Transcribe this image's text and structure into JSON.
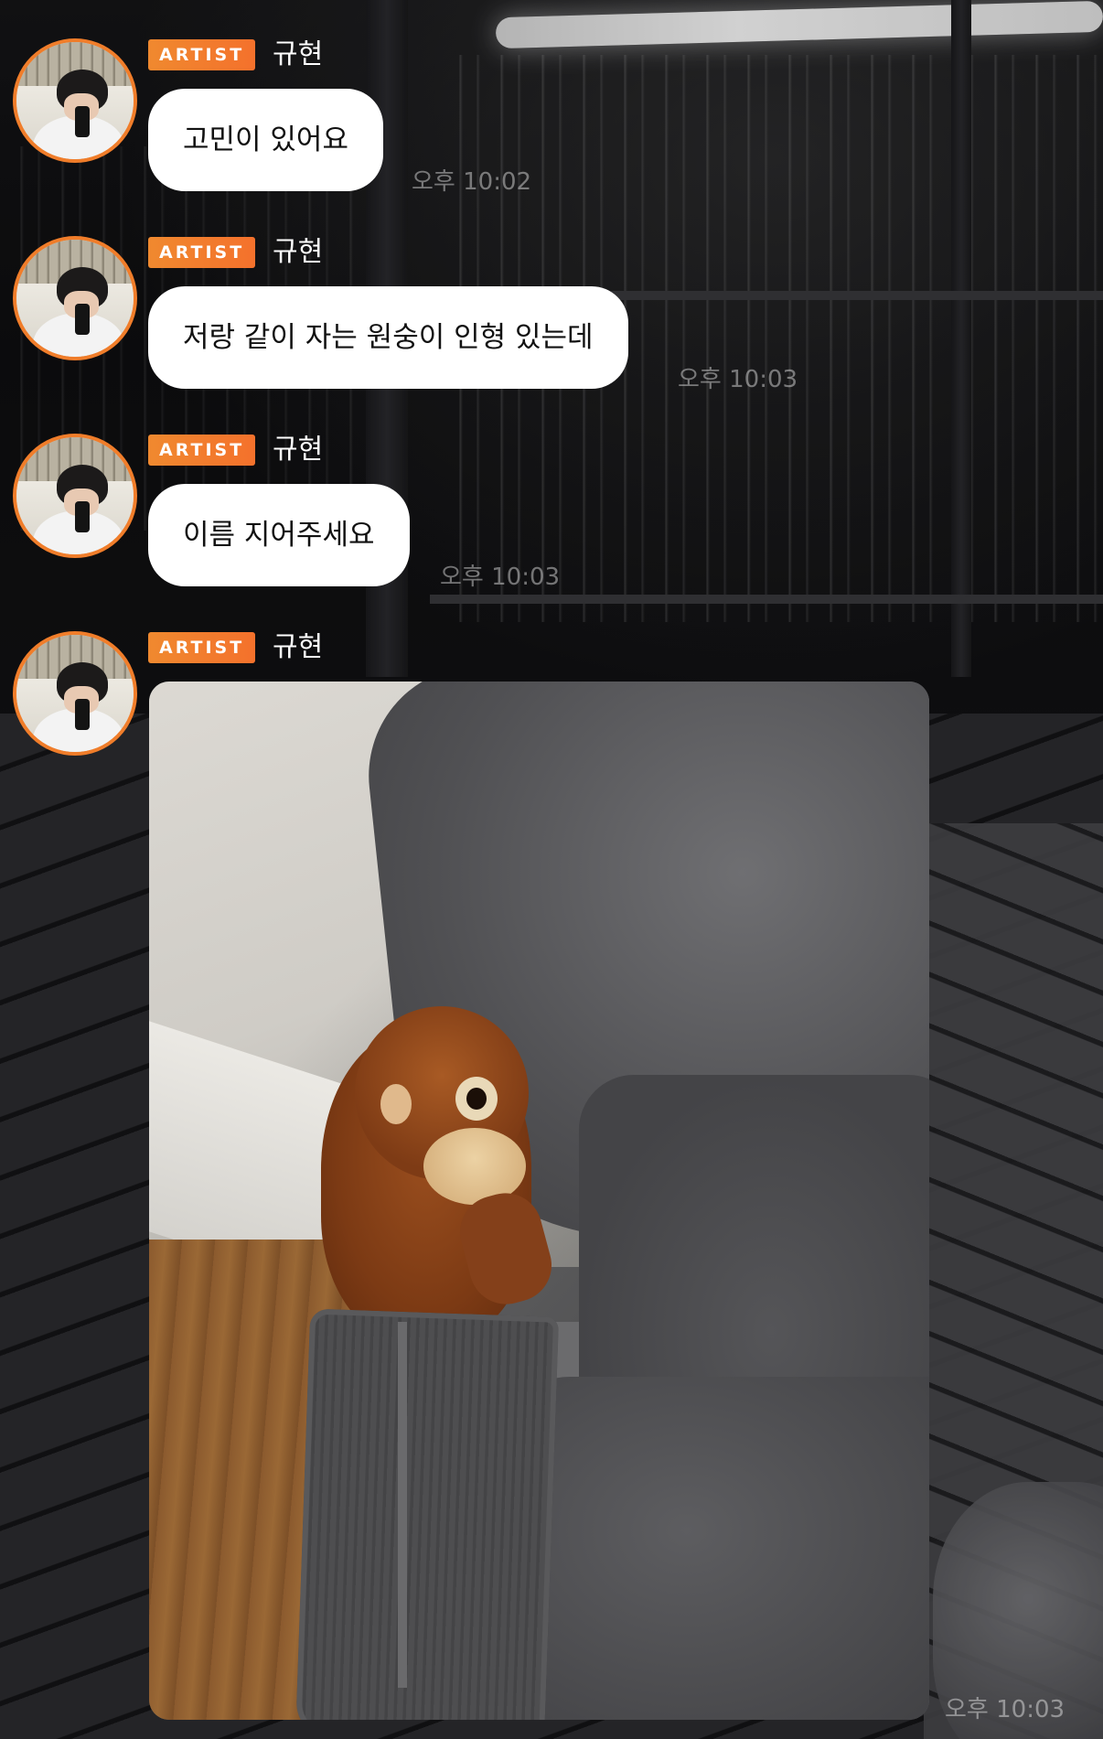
{
  "messages": [
    {
      "badge": "ARTIST",
      "sender": "규현",
      "text": "고민이 있어요",
      "time": "오후 10:02"
    },
    {
      "badge": "ARTIST",
      "sender": "규현",
      "text": "저랑 같이 자는 원숭이 인형 있는데",
      "time": "오후 10:03"
    },
    {
      "badge": "ARTIST",
      "sender": "규현",
      "text": "이름 지어주세요",
      "time": "오후 10:03"
    },
    {
      "badge": "ARTIST",
      "sender": "규현",
      "time": "오후 10:03"
    }
  ],
  "colors": {
    "accent": "#f07d2a",
    "bubble": "#ffffff",
    "bubble_text": "#111111",
    "sender_text": "#ffffff",
    "timestamp": "rgba(255,255,255,0.42)"
  },
  "icons": {
    "avatar": "artist-profile-avatar",
    "photo": "stuffed-orangutan-photo"
  }
}
